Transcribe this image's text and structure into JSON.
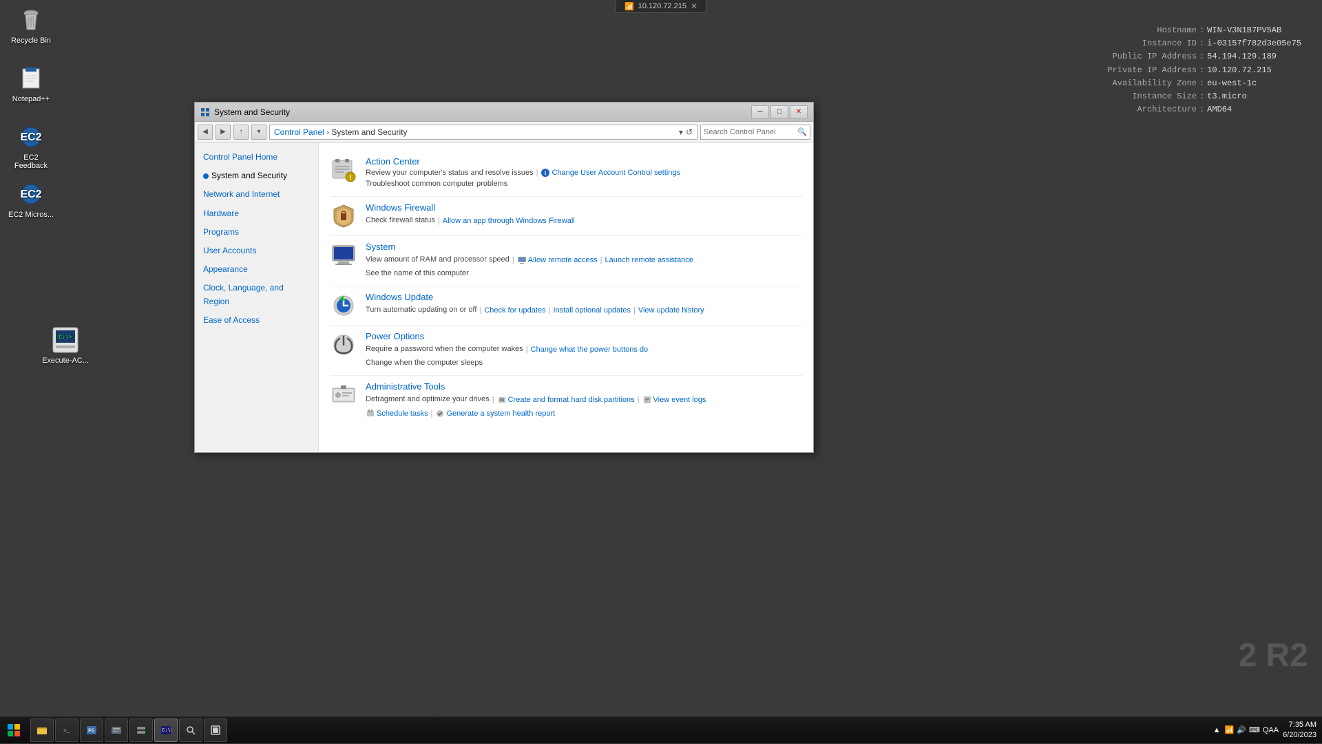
{
  "desktop": {
    "background_color": "#3a3a3a"
  },
  "system_info": {
    "hostname_label": "Hostname",
    "hostname_val": "WIN-V3N1B7PV5AB",
    "instance_id_label": "Instance ID",
    "instance_id_val": "i-03157f782d3e05e75",
    "public_ip_label": "Public IP Address",
    "public_ip_val": "54.194.129.189",
    "private_ip_label": "Private IP Address",
    "private_ip_val": "10.120.72.215",
    "az_label": "Availability Zone",
    "az_val": "eu-west-1c",
    "size_label": "Instance Size",
    "size_val": "t3.micro",
    "arch_label": "Architecture",
    "arch_val": "AMD64"
  },
  "net_bar": {
    "ip": "10.120.72.215"
  },
  "r2_watermark": "2 R2",
  "desktop_icons": [
    {
      "id": "recycle-bin",
      "label": "Recycle Bin"
    },
    {
      "id": "notepad-plus",
      "label": "Notepad++"
    },
    {
      "id": "ec2-feedback",
      "label": "EC2 Feedback"
    },
    {
      "id": "ec2-micros",
      "label": "EC2 Micros..."
    },
    {
      "id": "execute-ac",
      "label": "Execute-AC..."
    }
  ],
  "window": {
    "title": "System and Security",
    "address": {
      "breadcrumb": "Control Panel › System and Security",
      "search_placeholder": "Search Control Panel"
    },
    "sidebar": {
      "items": [
        {
          "id": "control-panel-home",
          "label": "Control Panel Home",
          "active": false
        },
        {
          "id": "system-and-security",
          "label": "System and Security",
          "active": true
        },
        {
          "id": "network-and-internet",
          "label": "Network and Internet",
          "active": false
        },
        {
          "id": "hardware",
          "label": "Hardware",
          "active": false
        },
        {
          "id": "programs",
          "label": "Programs",
          "active": false
        },
        {
          "id": "user-accounts",
          "label": "User Accounts",
          "active": false
        },
        {
          "id": "appearance",
          "label": "Appearance",
          "active": false
        },
        {
          "id": "clock-language-region",
          "label": "Clock, Language, and Region",
          "active": false
        },
        {
          "id": "ease-of-access",
          "label": "Ease of Access",
          "active": false
        }
      ]
    },
    "categories": [
      {
        "id": "action-center",
        "title": "Action Center",
        "description": "Review your computer's status and resolve issues",
        "description2": "Troubleshoot common computer problems",
        "links": [
          {
            "id": "change-uac",
            "label": "Change User Account Control settings",
            "has_icon": true
          },
          {
            "id": "troubleshoot",
            "label": "Troubleshoot common computer problems",
            "in_desc": true
          }
        ]
      },
      {
        "id": "windows-firewall",
        "title": "Windows Firewall",
        "description": "Check firewall status",
        "links": [
          {
            "id": "allow-app-firewall",
            "label": "Allow an app through Windows Firewall",
            "has_icon": false
          }
        ]
      },
      {
        "id": "system",
        "title": "System",
        "description": "View amount of RAM and processor speed",
        "description2": "See the name of this computer",
        "links": [
          {
            "id": "allow-remote-access",
            "label": "Allow remote access",
            "has_icon": true
          },
          {
            "id": "launch-remote-assistance",
            "label": "Launch remote assistance",
            "has_icon": false
          }
        ]
      },
      {
        "id": "windows-update",
        "title": "Windows Update",
        "description": "Turn automatic updating on or off",
        "links": [
          {
            "id": "check-for-updates",
            "label": "Check for updates"
          },
          {
            "id": "install-optional-updates",
            "label": "Install optional updates"
          },
          {
            "id": "view-update-history",
            "label": "View update history"
          }
        ]
      },
      {
        "id": "power-options",
        "title": "Power Options",
        "description": "Require a password when the computer wakes",
        "description2": "Change when the computer sleeps",
        "links": [
          {
            "id": "change-power-buttons",
            "label": "Change what the power buttons do"
          }
        ]
      },
      {
        "id": "administrative-tools",
        "title": "Administrative Tools",
        "description": "Defragment and optimize your drives",
        "links": [
          {
            "id": "create-format-disk",
            "label": "Create and format hard disk partitions",
            "has_icon": true
          },
          {
            "id": "view-event-logs",
            "label": "View event logs",
            "has_icon": true
          },
          {
            "id": "schedule-tasks",
            "label": "Schedule tasks",
            "has_icon": true
          },
          {
            "id": "generate-health-report",
            "label": "Generate a system health report",
            "has_icon": true
          }
        ]
      }
    ]
  },
  "taskbar": {
    "start_icon": "⊞",
    "buttons": [
      {
        "id": "file-explorer",
        "icon": "📁"
      },
      {
        "id": "terminal",
        "icon": ">"
      },
      {
        "id": "files",
        "icon": "🗂"
      },
      {
        "id": "server-manager",
        "icon": "🖥"
      },
      {
        "id": "cmd",
        "icon": "▶"
      },
      {
        "id": "search",
        "icon": "🔍"
      },
      {
        "id": "tasks",
        "icon": "📋"
      }
    ],
    "tray_label": "QAA",
    "time": "7:35 AM",
    "date": "6/20/2023"
  }
}
